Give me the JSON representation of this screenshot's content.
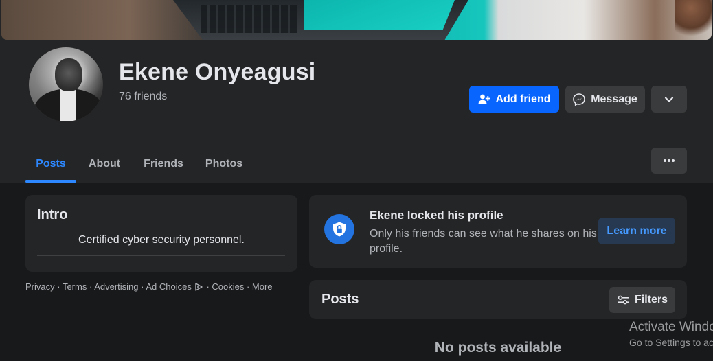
{
  "profile": {
    "name": "Ekene Onyeagusi",
    "friends_count": "76 friends"
  },
  "actions": {
    "add_friend_label": "Add friend",
    "message_label": "Message"
  },
  "tabs": [
    {
      "label": "Posts",
      "active": true
    },
    {
      "label": "About",
      "active": false
    },
    {
      "label": "Friends",
      "active": false
    },
    {
      "label": "Photos",
      "active": false
    }
  ],
  "intro": {
    "title": "Intro",
    "bio": "Certified cyber security personnel."
  },
  "footer": {
    "privacy": "Privacy",
    "terms": "Terms",
    "advertising": "Advertising",
    "ad_choices": "Ad Choices",
    "cookies": "Cookies",
    "more": "More",
    "separator": " · "
  },
  "locked": {
    "title": "Ekene locked his profile",
    "text": "Only his friends can see what he shares on his profile.",
    "learn_more_label": "Learn more"
  },
  "posts": {
    "title": "Posts",
    "filters_label": "Filters",
    "empty_text": "No posts available"
  },
  "watermark": {
    "title": "Activate Windows",
    "subtitle": "Go to Settings to activate Windows."
  },
  "colors": {
    "accent": "#0866ff",
    "link": "#2d88ff",
    "background": "#18191a",
    "surface": "#242526"
  },
  "icons": {
    "add_friend": "person-plus-icon",
    "message": "messenger-icon",
    "dropdown": "chevron-down-icon",
    "more": "more-horizontal-icon",
    "shield": "shield-lock-icon",
    "filters": "sliders-icon",
    "ad_choices": "ad-choices-icon"
  }
}
